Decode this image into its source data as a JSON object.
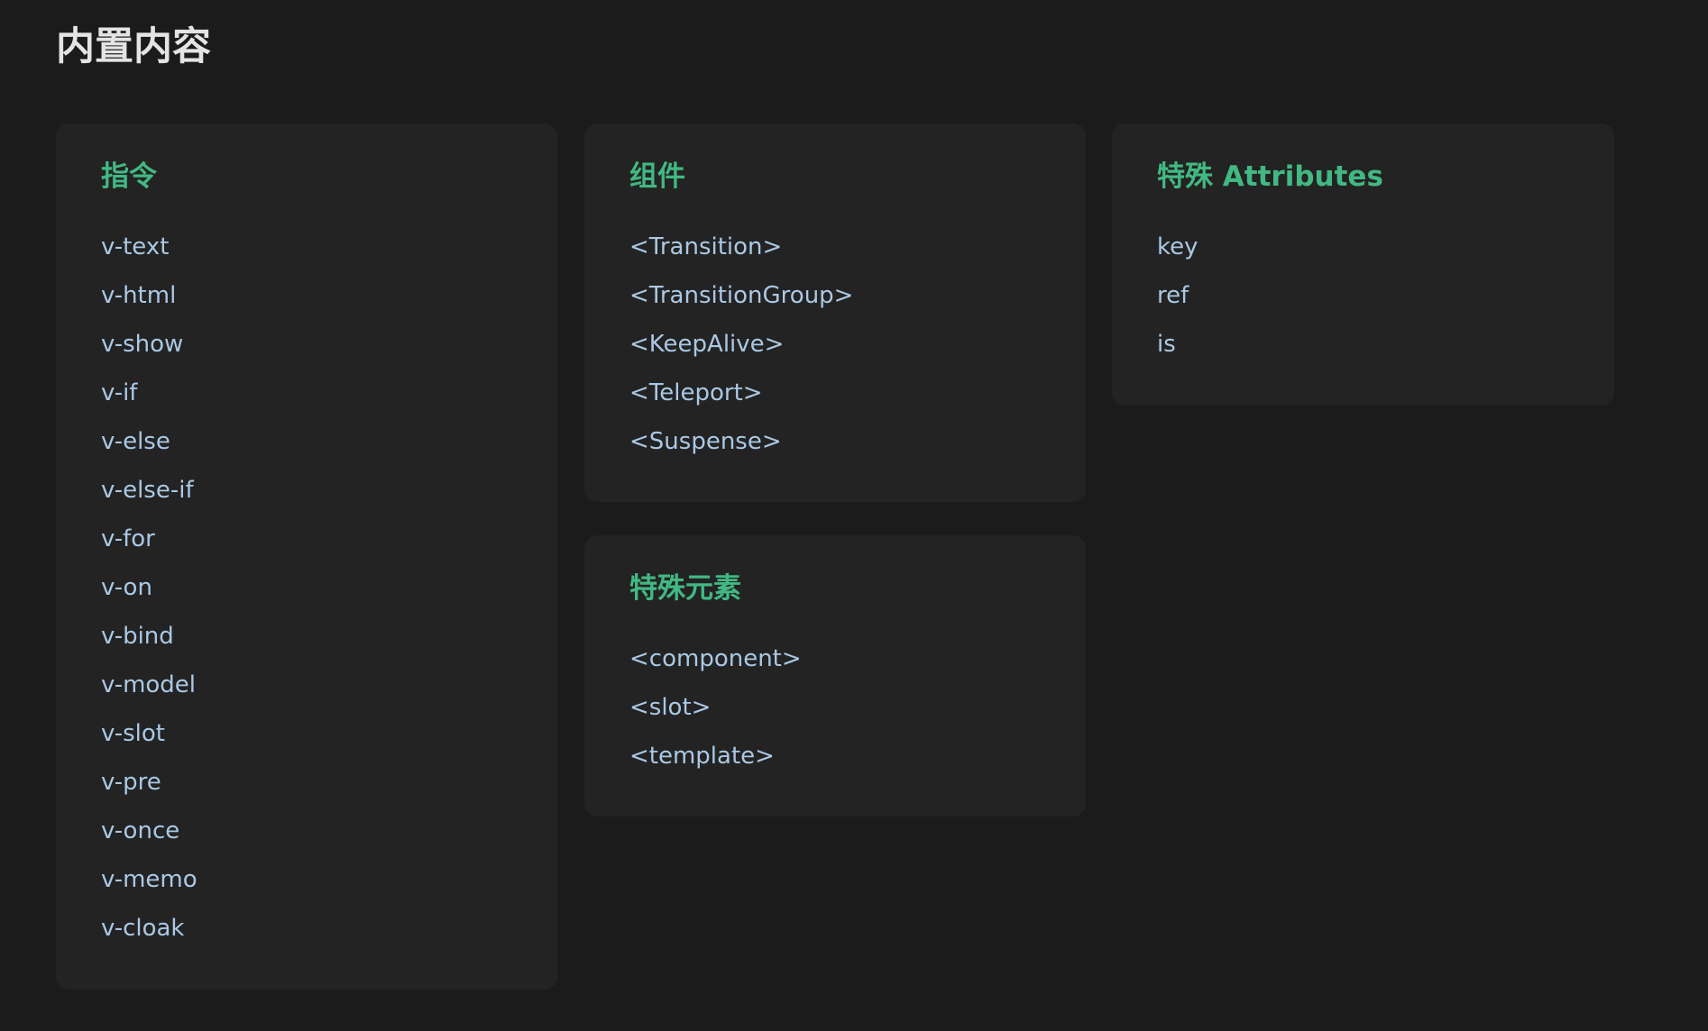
{
  "page": {
    "title": "内置内容"
  },
  "sections": {
    "directives": {
      "title": "指令",
      "items": [
        "v-text",
        "v-html",
        "v-show",
        "v-if",
        "v-else",
        "v-else-if",
        "v-for",
        "v-on",
        "v-bind",
        "v-model",
        "v-slot",
        "v-pre",
        "v-once",
        "v-memo",
        "v-cloak"
      ]
    },
    "components": {
      "title": "组件",
      "items": [
        "<Transition>",
        "<TransitionGroup>",
        "<KeepAlive>",
        "<Teleport>",
        "<Suspense>"
      ]
    },
    "special_elements": {
      "title": "特殊元素",
      "items": [
        "<component>",
        "<slot>",
        "<template>"
      ]
    },
    "special_attributes": {
      "title": "特殊 Attributes",
      "items": [
        "key",
        "ref",
        "is"
      ]
    }
  },
  "colors": {
    "background": "#1b1b1b",
    "card": "#232323",
    "accent": "#42b883",
    "link": "#aac8e4",
    "heading": "#e4e4e4"
  }
}
